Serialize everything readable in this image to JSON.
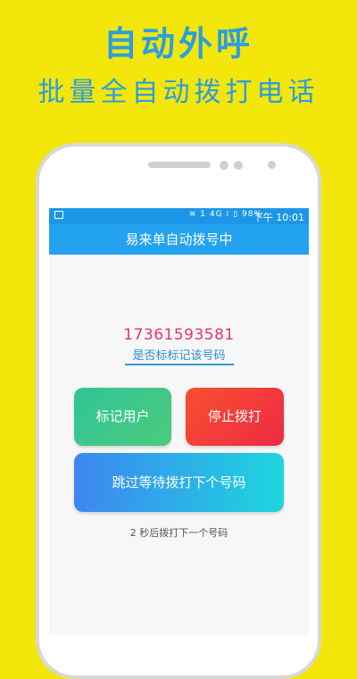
{
  "banner": {
    "title": "自动外呼",
    "subtitle": "批量全自动拨打电话"
  },
  "status_bar": {
    "icons": "≋ 1 4G ⁞ ▯ 98%",
    "time": "下午 10:01"
  },
  "app": {
    "title": "易来单自动拨号中",
    "phone_number": "17361593581",
    "phone_hint": "是否标标记该号码",
    "buttons": {
      "mark_user": "标记用户",
      "stop_dialing": "停止拨打",
      "skip_next": "跳过等待拨打下个号码"
    },
    "countdown": "2 秒后拨打下一个号码"
  },
  "colors": {
    "background": "#F2E60A",
    "accent": "#23A2F0",
    "phone_number": "#E5336E",
    "mark_button": "#30C49A",
    "stop_button": "#EE2A45",
    "skip_button_start": "#3D86F1",
    "skip_button_end": "#1DD6DE"
  }
}
